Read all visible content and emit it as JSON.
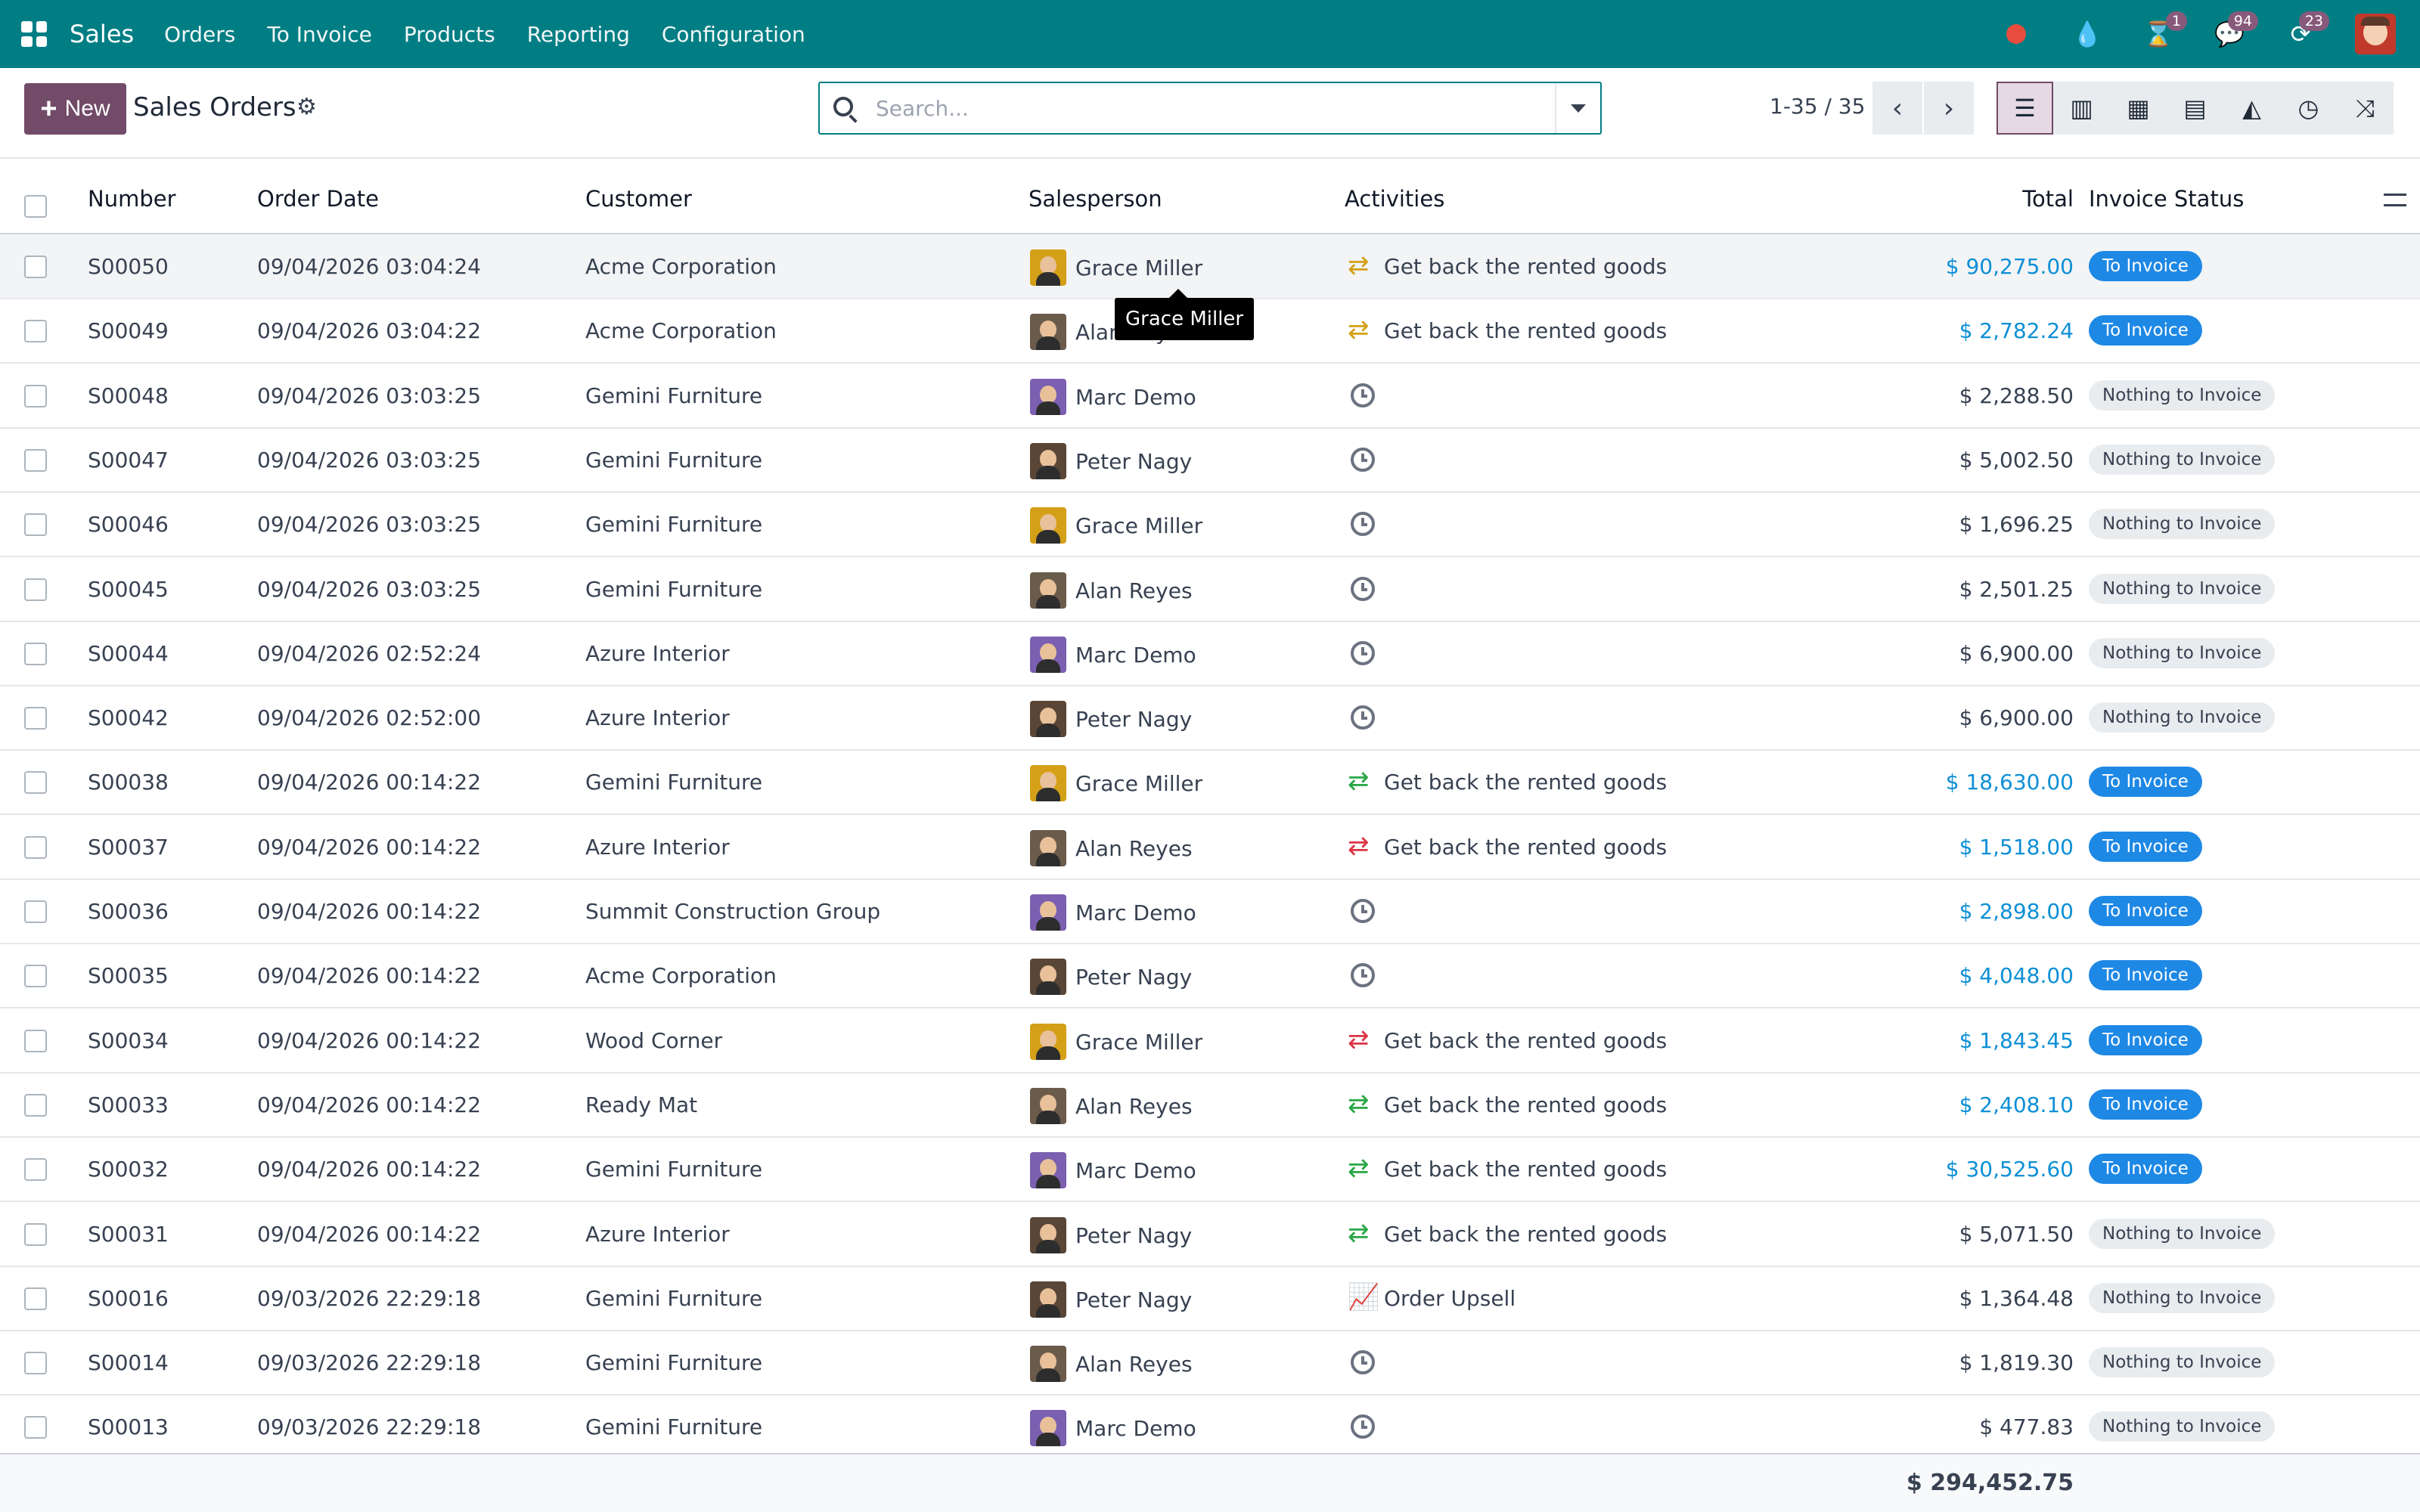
{
  "navbar": {
    "app_name": "Sales",
    "menu": [
      "Orders",
      "To Invoice",
      "Products",
      "Reporting",
      "Configuration"
    ],
    "activity_count": "1",
    "messages_count": "94",
    "clock_count": "23"
  },
  "control": {
    "new_label": "New",
    "title": "Sales Orders",
    "search_placeholder": "Search...",
    "pager": "1-35 / 35"
  },
  "columns": {
    "number": "Number",
    "date": "Order Date",
    "customer": "Customer",
    "salesperson": "Salesperson",
    "activities": "Activities",
    "total": "Total",
    "invoice_status": "Invoice Status"
  },
  "rows": [
    {
      "number": "S00050",
      "date": "09/04/2026 03:04:24",
      "customer": "Acme Corporation",
      "salesperson": "Grace Miller",
      "avatar": "grace",
      "activity": "Get back the rented goods",
      "activity_icon": "exchange-icon",
      "activity_color": "#d4a017",
      "total": "$ 90,275.00",
      "status": "To Invoice"
    },
    {
      "number": "S00049",
      "date": "09/04/2026 03:04:22",
      "customer": "Acme Corporation",
      "salesperson": "Alan Reyes",
      "avatar": "alan",
      "activity": "Get back the rented goods",
      "activity_icon": "exchange-icon",
      "activity_color": "#d4a017",
      "total": "$ 2,782.24",
      "status": "To Invoice"
    },
    {
      "number": "S00048",
      "date": "09/04/2026 03:03:25",
      "customer": "Gemini Furniture",
      "salesperson": "Marc Demo",
      "avatar": "marc",
      "activity": "",
      "activity_icon": "clock-icon",
      "activity_color": "#6b7280",
      "total": "$ 2,288.50",
      "status": "Nothing to Invoice"
    },
    {
      "number": "S00047",
      "date": "09/04/2026 03:03:25",
      "customer": "Gemini Furniture",
      "salesperson": "Peter Nagy",
      "avatar": "peter",
      "activity": "",
      "activity_icon": "clock-icon",
      "activity_color": "#6b7280",
      "total": "$ 5,002.50",
      "status": "Nothing to Invoice"
    },
    {
      "number": "S00046",
      "date": "09/04/2026 03:03:25",
      "customer": "Gemini Furniture",
      "salesperson": "Grace Miller",
      "avatar": "grace",
      "activity": "",
      "activity_icon": "clock-icon",
      "activity_color": "#6b7280",
      "total": "$ 1,696.25",
      "status": "Nothing to Invoice"
    },
    {
      "number": "S00045",
      "date": "09/04/2026 03:03:25",
      "customer": "Gemini Furniture",
      "salesperson": "Alan Reyes",
      "avatar": "alan",
      "activity": "",
      "activity_icon": "clock-icon",
      "activity_color": "#6b7280",
      "total": "$ 2,501.25",
      "status": "Nothing to Invoice"
    },
    {
      "number": "S00044",
      "date": "09/04/2026 02:52:24",
      "customer": "Azure Interior",
      "salesperson": "Marc Demo",
      "avatar": "marc",
      "activity": "",
      "activity_icon": "clock-icon",
      "activity_color": "#6b7280",
      "total": "$ 6,900.00",
      "status": "Nothing to Invoice"
    },
    {
      "number": "S00042",
      "date": "09/04/2026 02:52:00",
      "customer": "Azure Interior",
      "salesperson": "Peter Nagy",
      "avatar": "peter",
      "activity": "",
      "activity_icon": "clock-icon",
      "activity_color": "#6b7280",
      "total": "$ 6,900.00",
      "status": "Nothing to Invoice"
    },
    {
      "number": "S00038",
      "date": "09/04/2026 00:14:22",
      "customer": "Gemini Furniture",
      "salesperson": "Grace Miller",
      "avatar": "grace",
      "activity": "Get back the rented goods",
      "activity_icon": "exchange-icon",
      "activity_color": "#28a745",
      "total": "$ 18,630.00",
      "status": "To Invoice"
    },
    {
      "number": "S00037",
      "date": "09/04/2026 00:14:22",
      "customer": "Azure Interior",
      "salesperson": "Alan Reyes",
      "avatar": "alan",
      "activity": "Get back the rented goods",
      "activity_icon": "exchange-icon",
      "activity_color": "#dc3545",
      "total": "$ 1,518.00",
      "status": "To Invoice"
    },
    {
      "number": "S00036",
      "date": "09/04/2026 00:14:22",
      "customer": "Summit Construction Group",
      "salesperson": "Marc Demo",
      "avatar": "marc",
      "activity": "",
      "activity_icon": "clock-icon",
      "activity_color": "#6b7280",
      "total": "$ 2,898.00",
      "status": "To Invoice"
    },
    {
      "number": "S00035",
      "date": "09/04/2026 00:14:22",
      "customer": "Acme Corporation",
      "salesperson": "Peter Nagy",
      "avatar": "peter",
      "activity": "",
      "activity_icon": "clock-icon",
      "activity_color": "#6b7280",
      "total": "$ 4,048.00",
      "status": "To Invoice"
    },
    {
      "number": "S00034",
      "date": "09/04/2026 00:14:22",
      "customer": "Wood Corner",
      "salesperson": "Grace Miller",
      "avatar": "grace",
      "activity": "Get back the rented goods",
      "activity_icon": "exchange-icon",
      "activity_color": "#dc3545",
      "total": "$ 1,843.45",
      "status": "To Invoice"
    },
    {
      "number": "S00033",
      "date": "09/04/2026 00:14:22",
      "customer": "Ready Mat",
      "salesperson": "Alan Reyes",
      "avatar": "alan",
      "activity": "Get back the rented goods",
      "activity_icon": "exchange-icon",
      "activity_color": "#28a745",
      "total": "$ 2,408.10",
      "status": "To Invoice"
    },
    {
      "number": "S00032",
      "date": "09/04/2026 00:14:22",
      "customer": "Gemini Furniture",
      "salesperson": "Marc Demo",
      "avatar": "marc",
      "activity": "Get back the rented goods",
      "activity_icon": "exchange-icon",
      "activity_color": "#28a745",
      "total": "$ 30,525.60",
      "status": "To Invoice"
    },
    {
      "number": "S00031",
      "date": "09/04/2026 00:14:22",
      "customer": "Azure Interior",
      "salesperson": "Peter Nagy",
      "avatar": "peter",
      "activity": "Get back the rented goods",
      "activity_icon": "exchange-icon",
      "activity_color": "#28a745",
      "total": "$ 5,071.50",
      "status": "Nothing to Invoice"
    },
    {
      "number": "S00016",
      "date": "09/03/2026 22:29:18",
      "customer": "Gemini Furniture",
      "salesperson": "Peter Nagy",
      "avatar": "peter",
      "activity": "Order Upsell",
      "activity_icon": "trend-up-icon",
      "activity_color": "#d4a017",
      "total": "$ 1,364.48",
      "status": "Nothing to Invoice"
    },
    {
      "number": "S00014",
      "date": "09/03/2026 22:29:18",
      "customer": "Gemini Furniture",
      "salesperson": "Alan Reyes",
      "avatar": "alan",
      "activity": "",
      "activity_icon": "clock-icon",
      "activity_color": "#6b7280",
      "total": "$ 1,819.30",
      "status": "Nothing to Invoice"
    },
    {
      "number": "S00013",
      "date": "09/03/2026 22:29:18",
      "customer": "Gemini Furniture",
      "salesperson": "Marc Demo",
      "avatar": "marc",
      "activity": "",
      "activity_icon": "clock-icon",
      "activity_color": "#6b7280",
      "total": "$ 477.83",
      "status": "Nothing to Invoice"
    }
  ],
  "footer": {
    "grand_total": "$ 294,452.75"
  },
  "tooltip": {
    "text": "Grace Miller"
  },
  "colors": {
    "brand": "#017e84",
    "primary": "#714b67",
    "link_blue": "#0d8fd6",
    "status_blue": "#1e88e5"
  }
}
